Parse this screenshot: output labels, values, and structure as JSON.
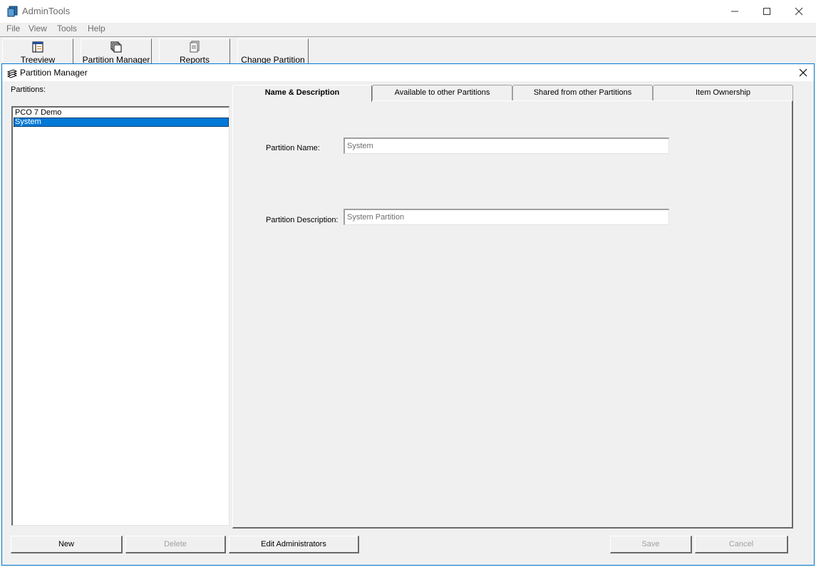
{
  "window": {
    "title": "AdminTools",
    "controls": {
      "minimize": "minimize-icon",
      "maximize": "maximize-icon",
      "close": "close-icon"
    }
  },
  "menu": [
    {
      "label": "File"
    },
    {
      "label": "View"
    },
    {
      "label": "Tools"
    },
    {
      "label": "Help"
    }
  ],
  "toolbar": [
    {
      "label": "Treeview",
      "icon": "treeview-icon"
    },
    {
      "label": "Partition Manager",
      "icon": "partition-manager-icon"
    },
    {
      "label": "Reports",
      "icon": "reports-icon"
    },
    {
      "label": "Change Partition",
      "icon": ""
    }
  ],
  "dialog": {
    "title": "Partition Manager",
    "icon": "partition-manager-icon",
    "partitions_label": "Partitions:",
    "partitions": [
      {
        "name": "PCO 7 Demo",
        "selected": false
      },
      {
        "name": "System",
        "selected": true
      }
    ],
    "tabs": [
      {
        "label": "Name & Description",
        "active": true
      },
      {
        "label": "Available to other Partitions",
        "active": false
      },
      {
        "label": "Shared from other Partitions",
        "active": false
      },
      {
        "label": "Item Ownership",
        "active": false
      }
    ],
    "fields": {
      "name": {
        "label": "Partition Name:",
        "value": "System"
      },
      "description": {
        "label": "Partition Description:",
        "value": "System Partition"
      }
    },
    "buttons": {
      "new": "New",
      "delete": "Delete",
      "edit_admins": "Edit Administrators",
      "save": "Save",
      "cancel": "Cancel"
    }
  },
  "colors": {
    "selection": "#0078d7",
    "window_bg": "#f0f0f0",
    "disabled_text": "#a0a0a0"
  }
}
